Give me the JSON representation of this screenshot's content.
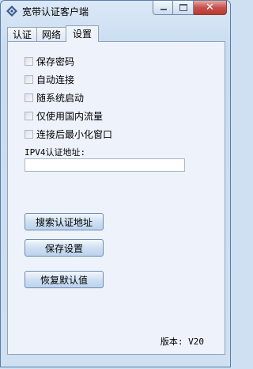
{
  "window": {
    "title": "宽带认证客户端",
    "close_glyph": "✕"
  },
  "tabs": [
    {
      "label": "认证",
      "active": false
    },
    {
      "label": "网络",
      "active": false
    },
    {
      "label": "设置",
      "active": true
    }
  ],
  "settings": {
    "checkboxes": [
      {
        "label": "保存密码",
        "checked": false
      },
      {
        "label": "自动连接",
        "checked": false
      },
      {
        "label": "随系统启动",
        "checked": false
      },
      {
        "label": "仅使用国内流量",
        "checked": false
      },
      {
        "label": "连接后最小化窗口",
        "checked": false
      }
    ],
    "ip_label": "IPV4认证地址:",
    "ip_value": "",
    "buttons": {
      "search": "搜索认证地址",
      "save": "保存设置",
      "restore": "恢复默认值"
    },
    "version": "版本: V20"
  },
  "colors": {
    "accent": "#6f8bb0",
    "close": "#c75050"
  }
}
